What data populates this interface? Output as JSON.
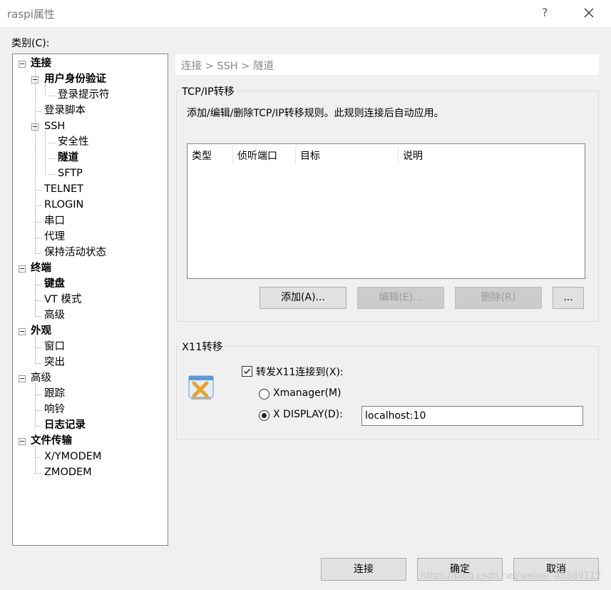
{
  "window": {
    "title": "raspi属性",
    "help": "?",
    "close_icon": "close-icon"
  },
  "category_label": "类别(C):",
  "tree": {
    "items": [
      {
        "label": "连接",
        "level": 0,
        "bold": true,
        "expander": true
      },
      {
        "label": "用户身份验证",
        "level": 1,
        "bold": true,
        "expander": true
      },
      {
        "label": "登录提示符",
        "level": 2
      },
      {
        "label": "登录脚本",
        "level": 1
      },
      {
        "label": "SSH",
        "level": 1,
        "expander": true
      },
      {
        "label": "安全性",
        "level": 2
      },
      {
        "label": "隧道",
        "level": 2,
        "bold": true,
        "selected": true
      },
      {
        "label": "SFTP",
        "level": 2
      },
      {
        "label": "TELNET",
        "level": 1
      },
      {
        "label": "RLOGIN",
        "level": 1
      },
      {
        "label": "串口",
        "level": 1
      },
      {
        "label": "代理",
        "level": 1
      },
      {
        "label": "保持活动状态",
        "level": 1
      },
      {
        "label": "终端",
        "level": 0,
        "bold": true,
        "expander": true
      },
      {
        "label": "键盘",
        "level": 1,
        "bold": true
      },
      {
        "label": "VT 模式",
        "level": 1
      },
      {
        "label": "高级",
        "level": 1
      },
      {
        "label": "外观",
        "level": 0,
        "bold": true,
        "expander": true
      },
      {
        "label": "窗口",
        "level": 1
      },
      {
        "label": "突出",
        "level": 1
      },
      {
        "label": "高级",
        "level": 0,
        "expander": true
      },
      {
        "label": "跟踪",
        "level": 1
      },
      {
        "label": "响铃",
        "level": 1
      },
      {
        "label": "日志记录",
        "level": 1,
        "bold": true
      },
      {
        "label": "文件传输",
        "level": 0,
        "bold": true,
        "expander": true
      },
      {
        "label": "X/YMODEM",
        "level": 1
      },
      {
        "label": "ZMODEM",
        "level": 1
      }
    ]
  },
  "breadcrumb": "连接 > SSH > 隧道",
  "tcp": {
    "legend": "TCP/IP转移",
    "description": "添加/编辑/删除TCP/IP转移规则。此规则连接后自动应用。",
    "columns": [
      "类型",
      "侦听端口",
      "目标",
      "说明"
    ],
    "buttons": {
      "add": "添加(A)...",
      "edit": "编辑(E)...",
      "delete": "删除(R)",
      "more": "..."
    }
  },
  "x11": {
    "legend": "X11转移",
    "icon": "xmanager-icon",
    "forward_label": "转发X11连接到(X):",
    "forward_checked": true,
    "xmanager_label": "Xmanager(M)",
    "display_label": "X DISPLAY(D):",
    "display_value": "localhost:10",
    "selected_option": "X DISPLAY"
  },
  "footer": {
    "connect": "连接",
    "ok": "确定",
    "cancel": "取消"
  },
  "watermark": "https://blog.csdn.net/weixin_45589112"
}
